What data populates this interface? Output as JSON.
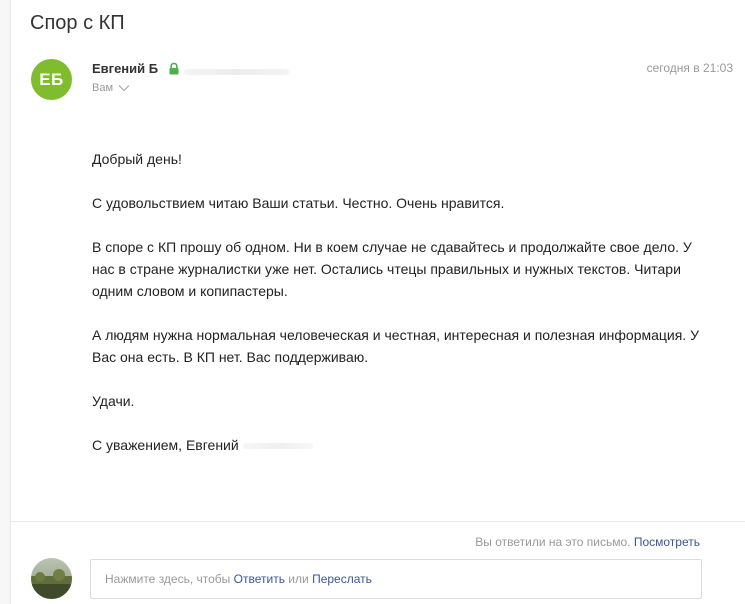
{
  "message": {
    "subject": "Спор с КП",
    "sender": {
      "initials": "ЕБ",
      "name": "Евгений Б",
      "avatar_color": "#7fbd2e",
      "verified_icon": "lock-icon"
    },
    "recipient": "Вам",
    "timestamp": "сегодня в 21:03",
    "body": [
      "Добрый день!",
      "С удовольствием читаю Ваши статьи. Честно. Очень нравится.",
      "В споре с КП прошу об одном. Ни в коем случае не сдавайтесь и продолжайте свое дело. У нас в стране журналистки уже нет. Остались чтецы правильных и нужных текстов. Читари одним словом и копипастеры.",
      "А людям нужна нормальная человеческая и честная, интересная и полезная информация. У Вас она есть. В КП нет. Вас поддерживаю.",
      "Удачи.",
      "С уважением, Евгений"
    ]
  },
  "reply_status": {
    "text": "Вы ответили на это письмо.",
    "view_link": "Посмотреть"
  },
  "reply_box": {
    "prefix": "Нажмите здесь, чтобы",
    "reply_link": "Ответить",
    "or": "или",
    "forward_link": "Переслать"
  },
  "colors": {
    "link": "#3a5795",
    "muted": "#999999",
    "verified": "#4caf50"
  }
}
